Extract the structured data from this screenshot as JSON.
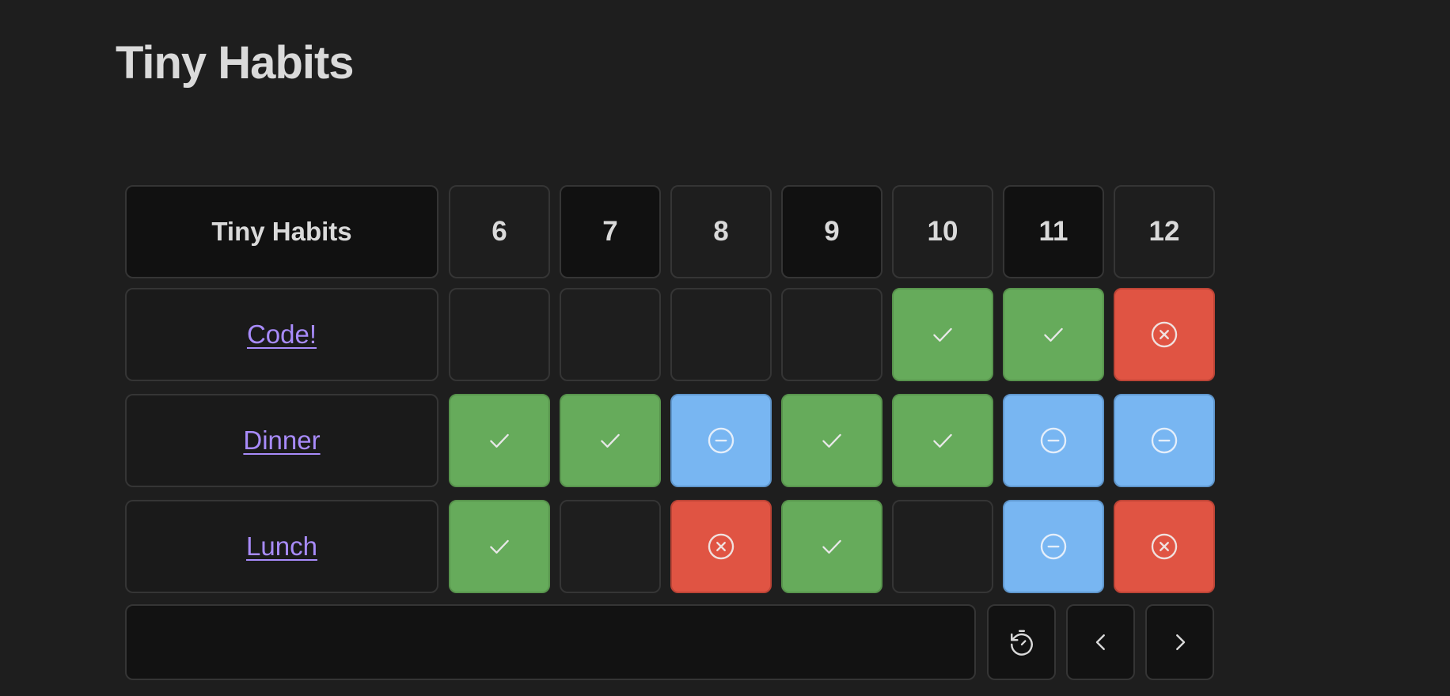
{
  "title": "Tiny Habits",
  "table": {
    "header_label": "Tiny Habits",
    "days": [
      "6",
      "7",
      "8",
      "9",
      "10",
      "11",
      "12"
    ],
    "rows": [
      {
        "name": "Code!",
        "statuses": [
          "empty",
          "empty",
          "empty",
          "empty",
          "done",
          "done",
          "failed"
        ]
      },
      {
        "name": "Dinner",
        "statuses": [
          "done",
          "done",
          "skipped",
          "done",
          "done",
          "skipped",
          "skipped"
        ]
      },
      {
        "name": "Lunch",
        "statuses": [
          "done",
          "empty",
          "failed",
          "done",
          "empty",
          "skipped",
          "failed"
        ]
      }
    ]
  },
  "status_icons": {
    "done": "check-icon",
    "failed": "x-circle-icon",
    "skipped": "minus-circle-icon",
    "empty": ""
  },
  "colors": {
    "done": "#66ab5b",
    "failed": "#e05443",
    "skipped": "#78b6f2",
    "link": "#a88bfa",
    "background": "#1e1e1e"
  },
  "footer": {
    "input_value": "",
    "buttons": [
      {
        "icon": "timer-reset-icon"
      },
      {
        "icon": "chevron-left-icon"
      },
      {
        "icon": "chevron-right-icon"
      }
    ]
  }
}
